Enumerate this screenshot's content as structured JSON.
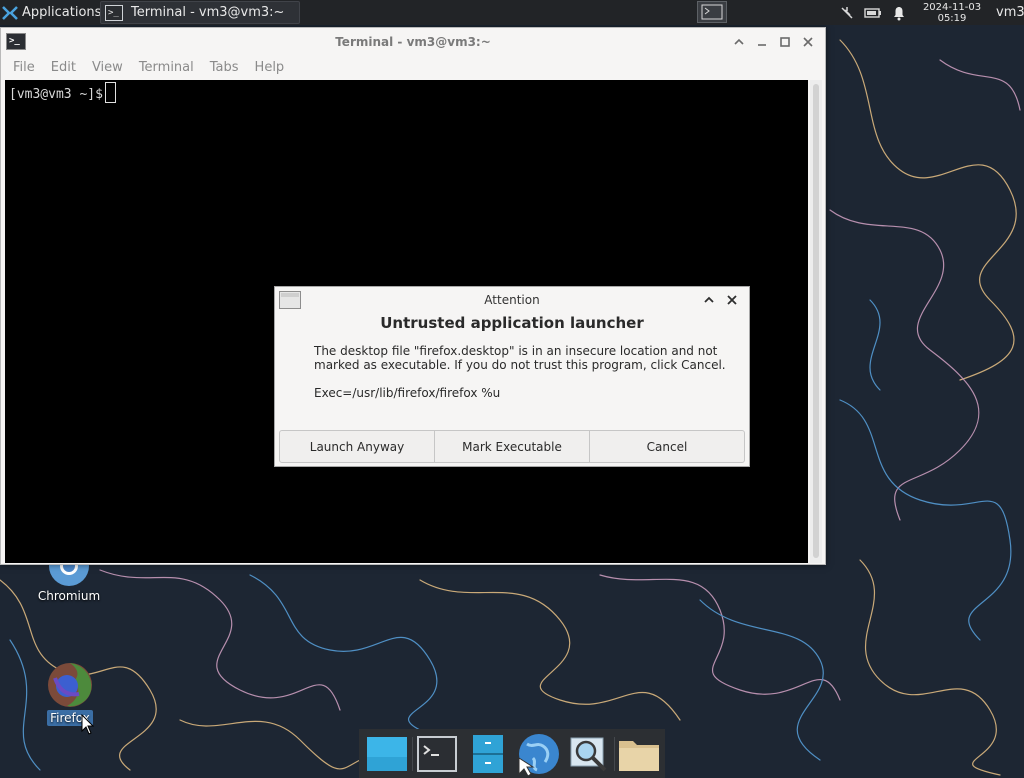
{
  "top_panel": {
    "applications_label": "Applications",
    "task_button_label": "Terminal - vm3@vm3:~",
    "clock_date": "2024-11-03",
    "clock_time": "05:19",
    "user": "vm3"
  },
  "desktop_icons": {
    "chromium": "Chromium",
    "firefox": "Firefox"
  },
  "terminal": {
    "title": "Terminal - vm3@vm3:~",
    "menu": [
      "File",
      "Edit",
      "View",
      "Terminal",
      "Tabs",
      "Help"
    ],
    "prompt": "[vm3@vm3 ~]$"
  },
  "dialog": {
    "title": "Attention",
    "heading": "Untrusted application launcher",
    "message": "The desktop file \"firefox.desktop\" is in an insecure location and not marked as executable. If you do not trust this program, click Cancel.",
    "exec": "Exec=/usr/lib/firefox/firefox %u",
    "buttons": {
      "launch": "Launch Anyway",
      "mark": "Mark Executable",
      "cancel": "Cancel"
    }
  },
  "dock": {
    "items": [
      "show-desktop",
      "terminal",
      "file-manager-split",
      "web-browser",
      "app-finder",
      "home-folder"
    ]
  },
  "colors": {
    "panel_bg": "#222427",
    "wallpaper_bg": "#1c2532",
    "selected_label": "#3b6ea5"
  }
}
